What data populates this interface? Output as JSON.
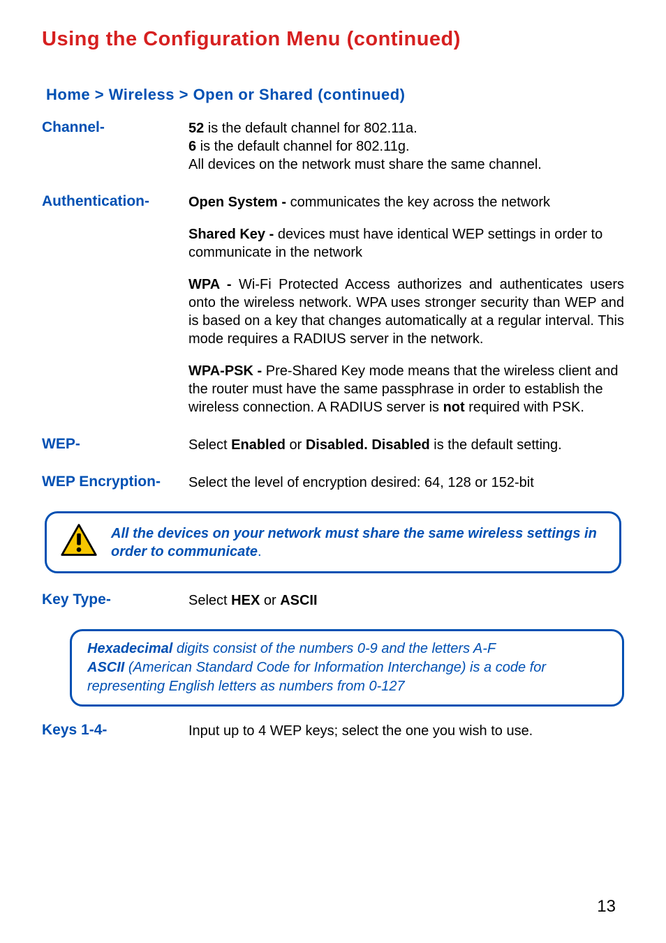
{
  "header": {
    "title": "Using the Configuration Menu (continued)"
  },
  "breadcrumb": {
    "text": "Home > Wireless > Open or Shared (continued)"
  },
  "channel": {
    "label": "Channel-",
    "bold_a": "52",
    "text_a": " is the default channel for 802.11a.",
    "bold_g": "6",
    "text_g": " is the default channel for 802.11g.",
    "text_all": "All devices on the network must share the same channel."
  },
  "auth": {
    "label": "Authentication-",
    "open_bold": "Open System -",
    "open_text": " communicates the key across the network",
    "shared_bold": "Shared Key -",
    "shared_text": " devices must have identical WEP settings in order to communicate in the network",
    "wpa_bold": "WPA -",
    "wpa_text": " Wi-Fi Protected Access authorizes and authenticates users onto the wireless network. WPA uses stronger security than WEP and is based on a key that changes automatically at a regular interval. This mode requires a RADIUS server in the network.",
    "psk_bold": "WPA-PSK -",
    "psk_text_1": " Pre-Shared Key mode means that the wireless client and the router must have the same passphrase in order to establish the wireless connection. A RADIUS server is ",
    "psk_not": "not",
    "psk_text_2": " required with PSK."
  },
  "wep": {
    "label": "WEP-",
    "pre": "Select ",
    "enabled": "Enabled",
    "or": " or ",
    "disabled_1": "Disabled.",
    "disabled_2": "  Disabled",
    "post": " is the default setting."
  },
  "wepenc": {
    "label": "WEP Encryption-",
    "text": "Select the level of encryption desired: 64, 128 or 152-bit"
  },
  "note1": {
    "text": "All the devices on your network must share the same wireless settings in order to communicate",
    "period": "."
  },
  "keytype": {
    "label": "Key Type-",
    "pre": "Select ",
    "hex": "HEX",
    "or": " or ",
    "ascii": "ASCII"
  },
  "note2": {
    "hex_bold": "Hexadecimal",
    "hex_text": " digits consist of the numbers 0-9 and the letters A-F",
    "ascii_bold": "ASCII",
    "ascii_text": " (American Standard Code for Information Interchange) is a code for representing English letters as numbers from 0-127"
  },
  "keys14": {
    "label": "Keys 1-4-",
    "text": "Input up to 4 WEP keys; select the one you wish to use."
  },
  "page": {
    "number": "13"
  }
}
